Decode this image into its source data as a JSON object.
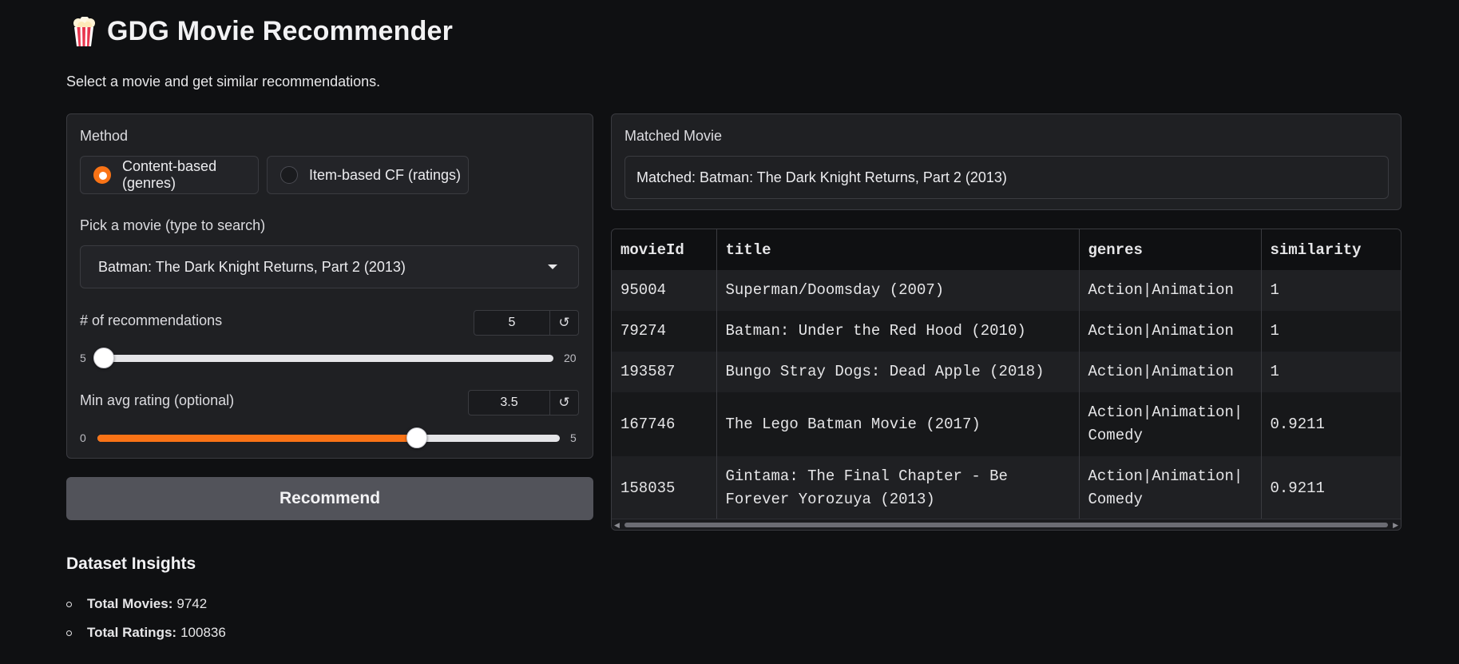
{
  "header": {
    "title": "GDG Movie Recommender",
    "subtitle": "Select a movie and get similar recommendations."
  },
  "icons": {
    "title_icon": "popcorn-icon",
    "dropdown": "chevron-down-icon",
    "reset": "reset-icon"
  },
  "colors": {
    "accent": "#f97316",
    "background": "#0f1012",
    "panel": "#1f2023",
    "button": "#52535a"
  },
  "controls": {
    "method_label": "Method",
    "methods": [
      {
        "label": "Content-based (genres)",
        "selected": true
      },
      {
        "label": "Item-based CF (ratings)",
        "selected": false
      }
    ],
    "movie_label": "Pick a movie (type to search)",
    "movie_selected": "Batman: The Dark Knight Returns, Part 2 (2013)",
    "recs": {
      "label": "# of recommendations",
      "value": "5",
      "min": "5",
      "max": "20",
      "reset_glyph": "↺"
    },
    "rating": {
      "label": "Min avg rating (optional)",
      "value": "3.5",
      "min": "0",
      "max": "5",
      "reset_glyph": "↺"
    },
    "recommend_label": "Recommend"
  },
  "matched": {
    "label": "Matched Movie",
    "text": "Matched: Batman: The Dark Knight Returns, Part 2 (2013)"
  },
  "table": {
    "headers": [
      "movieId",
      "title",
      "genres",
      "similarity"
    ],
    "rows": [
      [
        "95004",
        "Superman/Doomsday (2007)",
        "Action|Animation",
        "1"
      ],
      [
        "79274",
        "Batman: Under the Red Hood (2010)",
        "Action|Animation",
        "1"
      ],
      [
        "193587",
        "Bungo Stray Dogs: Dead Apple (2018)",
        "Action|Animation",
        "1"
      ],
      [
        "167746",
        "The Lego Batman Movie (2017)",
        "Action|Animation|\nComedy",
        "0.9211"
      ],
      [
        "158035",
        "Gintama: The Final Chapter - Be\nForever Yorozuya (2013)",
        "Action|Animation|\nComedy",
        "0.9211"
      ]
    ]
  },
  "insights": {
    "title": "Dataset Insights",
    "items": [
      {
        "label": "Total Movies:",
        "value": "9742"
      },
      {
        "label": "Total Ratings:",
        "value": "100836"
      }
    ]
  }
}
